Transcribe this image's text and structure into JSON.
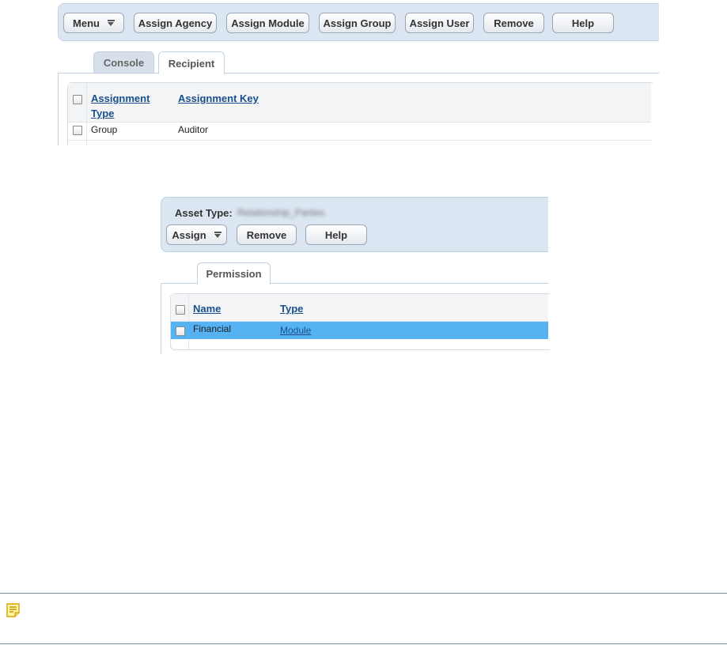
{
  "toolbar1": {
    "menu_label": "Menu",
    "assign_agency": "Assign Agency",
    "assign_module": "Assign Module",
    "assign_group": "Assign Group",
    "assign_user": "Assign User",
    "remove": "Remove",
    "help": "Help"
  },
  "tabs1": {
    "console": "Console",
    "recipient": "Recipient"
  },
  "grid1": {
    "col_assignment_type_line1": "Assignment",
    "col_assignment_type_line2": "Type",
    "col_assignment_key": "Assignment Key",
    "rows": [
      {
        "type": "Group",
        "key": "Auditor"
      }
    ]
  },
  "panel2": {
    "asset_type_label": "Asset Type:",
    "asset_type_value": "Relationship_Parties",
    "assign_label": "Assign",
    "remove": "Remove",
    "help": "Help"
  },
  "tabs2": {
    "permission": "Permission"
  },
  "grid2": {
    "col_name": "Name",
    "col_type": "Type",
    "rows": [
      {
        "name": "Financial",
        "type": "Module",
        "selected": true
      }
    ]
  },
  "colors": {
    "selected_row": "#55b3f3",
    "link": "#1a4f8a",
    "panel": "#dbe6f2"
  },
  "note": {
    "icon": "note-icon"
  }
}
